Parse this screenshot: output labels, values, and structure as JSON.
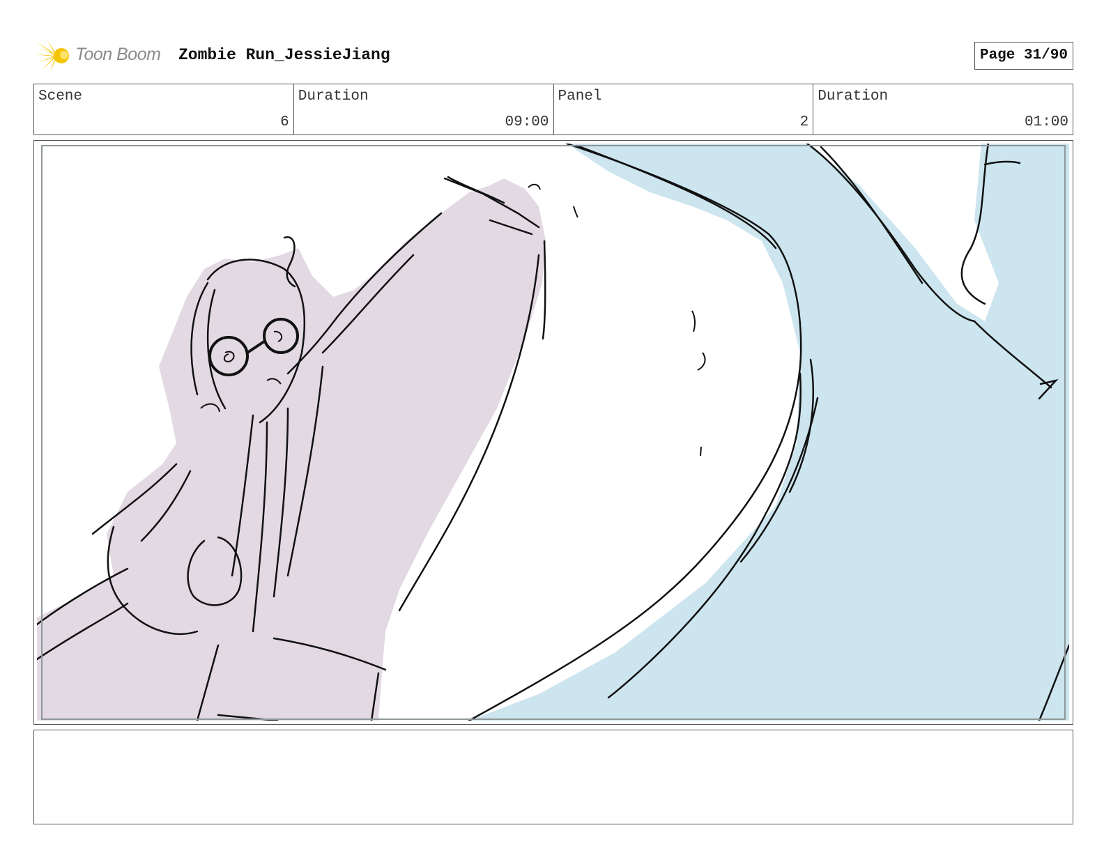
{
  "header": {
    "logo_text": "Toon Boom",
    "project_title": "Zombie Run_JessieJiang",
    "page_label": "Page 31/90"
  },
  "info": {
    "scene_label": "Scene",
    "scene_value": "6",
    "scene_duration_label": "Duration",
    "scene_duration_value": "09:00",
    "panel_label": "Panel",
    "panel_value": "2",
    "panel_duration_label": "Duration",
    "panel_duration_value": "01:00"
  },
  "panel": {
    "fill_colors": {
      "character": "#e2d9e3",
      "background": "#cce5ef",
      "ink": "#111111"
    }
  },
  "notes": {}
}
